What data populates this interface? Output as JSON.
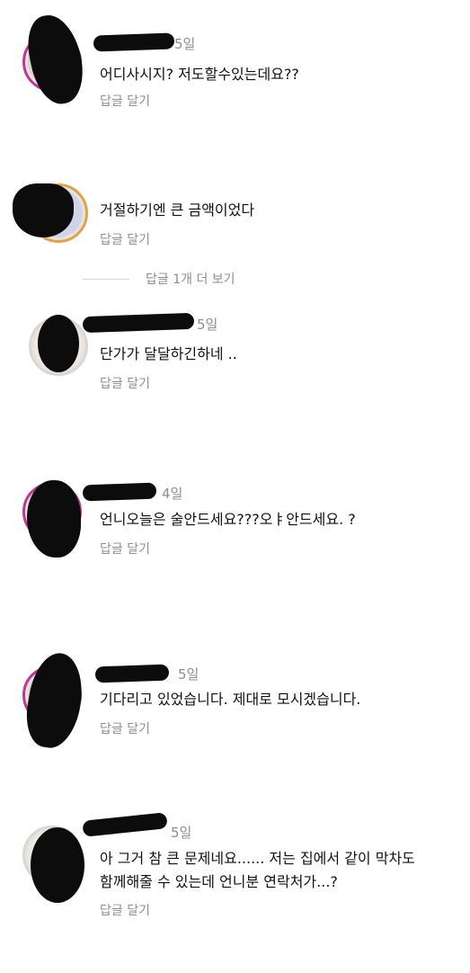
{
  "comments": [
    {
      "time": "5일",
      "text": "어디사시지? 저도할수있는데요??",
      "reply": "답글 달기"
    },
    {
      "time": "",
      "text": "거절하기엔 큰 금액이었다",
      "reply": "답글 달기"
    },
    {
      "time": "5일",
      "text": "단가가 달달하긴하네 ..",
      "reply": "답글 달기"
    },
    {
      "time": "4일",
      "text": "언니오늘은 술안드세요???오ㅑ안드세요. ?",
      "reply": "답글 달기"
    },
    {
      "time": "5일",
      "text": "기다리고 있었습니다. 제대로 모시겠습니다.",
      "reply": "답글 달기"
    },
    {
      "time": "5일",
      "text_line1": "아 그거 참 큰 문제네요...... 저는 집에서 같이 막차도",
      "text_line2": "함께해줄 수 있는데 언니분 연락처가...?",
      "reply": "답글 달기"
    }
  ],
  "view_more": "답글 1개 더 보기",
  "colors": {
    "ring": "#c1359a",
    "meta": "#8e8e8e",
    "redaction": "#0c0c0c"
  }
}
